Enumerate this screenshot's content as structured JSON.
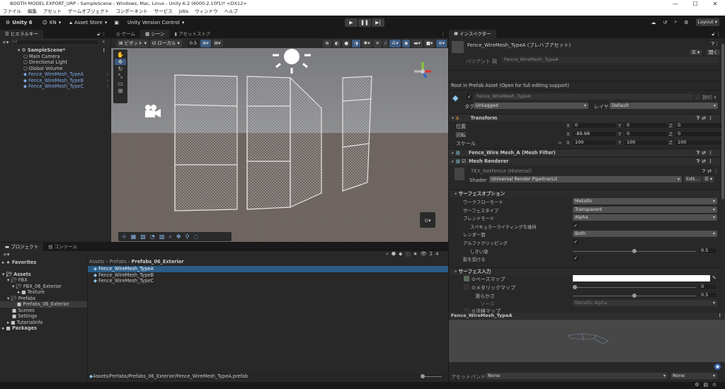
{
  "window": {
    "title": "BOOTH MODEL EXPORT_URP - SampleScene - Windows, Mac, Linux - Unity 6.2 (6000.2.10f1)* <DX12>",
    "minimize": "—",
    "maximize": "☐",
    "close": "✕"
  },
  "menu": [
    "ファイル",
    "編集",
    "アセット",
    "ゲームオブジェクト",
    "コンポーネント",
    "サービス",
    "Jobs",
    "ウィンドウ",
    "ヘルプ"
  ],
  "toolbar": {
    "unity": "Unity 6",
    "account": "KN",
    "asset_store": "Asset Store",
    "version_control": "Unity Version Control",
    "layout": "Layout"
  },
  "hierarchy": {
    "tab": "ヒエラルキー",
    "search_placeholder": "All",
    "scene": "SampleScene*",
    "items": [
      {
        "label": "Main Camera",
        "prefab": false
      },
      {
        "label": "Directional Light",
        "prefab": false
      },
      {
        "label": "Global Volume",
        "prefab": false
      },
      {
        "label": "Fence_WireMesh_TypeA",
        "prefab": true
      },
      {
        "label": "Fence_WireMesh_TypeB",
        "prefab": true
      },
      {
        "label": "Fence_WireMesh_TypeC",
        "prefab": true
      }
    ]
  },
  "scene_view": {
    "tabs": [
      "ゲーム",
      "シーン",
      "アセットストア"
    ],
    "active_tab": 1,
    "pivot": "ピボット",
    "local": "ローカル",
    "snap_value": "0.5"
  },
  "project": {
    "tabs": [
      "プロジェクト",
      "コンソール"
    ],
    "favorites": "Favorites",
    "tree": [
      {
        "label": "Assets",
        "depth": 0
      },
      {
        "label": "FBX",
        "depth": 1
      },
      {
        "label": "FBX_06_Exterior",
        "depth": 2
      },
      {
        "label": "Texture",
        "depth": 3
      },
      {
        "label": "Prefabs",
        "depth": 1
      },
      {
        "label": "Prefabs_06_Exterior",
        "depth": 2,
        "selected": true
      },
      {
        "label": "Scenes",
        "depth": 1
      },
      {
        "label": "Settings",
        "depth": 1
      },
      {
        "label": "TutorialInfo",
        "depth": 1
      },
      {
        "label": "Packages",
        "depth": 0
      }
    ],
    "breadcrumb": [
      "Assets",
      "Prefabs",
      "Prefabs_06_Exterior"
    ],
    "files": [
      "Fence_WireMesh_TypeA",
      "Fence_WireMesh_TypeB",
      "Fence_WireMesh_TypeC"
    ],
    "selected_path": "Assets/Prefabs/Prefabs_06_Exterior/Fence_WireMesh_TypeA.prefab",
    "count": "24"
  },
  "inspector": {
    "tab": "インスペクター",
    "asset_title": "Fence_WireMesh_TypeA (プレハブアセット)",
    "open": "開く",
    "variant_label": "バリアント 親",
    "variant_value": "Fence_WireMesh_TypeA",
    "root_notice": "Root in Prefab Asset (Open for full editing support)",
    "object_name": "Fence_WireMesh_TypeA",
    "static": "静的",
    "tag_label": "タグ",
    "tag": "Untagged",
    "layer_label": "レイヤー",
    "layer": "Default",
    "transform": {
      "title": "Transform",
      "rows": [
        {
          "label": "位置",
          "x": "0",
          "y": "0",
          "z": "0"
        },
        {
          "label": "回転",
          "x": "-89.98",
          "y": "0",
          "z": "0"
        },
        {
          "label": "スケール",
          "x": "100",
          "y": "100",
          "z": "100"
        }
      ]
    },
    "mesh_filter": "Fence_Wire Mesh_A (Mesh Filter)",
    "mesh_renderer": "Mesh Renderer",
    "material": "TEX_NetFence (Material)",
    "shader_label": "Shader",
    "shader": "Universal Render Pipeline/Lit",
    "edit": "Edit...",
    "surface_options": {
      "title": "サーフェスオプション",
      "workflow_label": "ワークフローモード",
      "workflow": "Metallic",
      "surface_type_label": "サーフェスタイプ",
      "surface_type": "Transparent",
      "blend_label": "ブレンドモード",
      "blend": "Alpha",
      "specular_label": "スペキュラーライティングを維持",
      "render_face_label": "レンダー面",
      "render_face": "Both",
      "alpha_clip_label": "アルファクリッピング",
      "threshold_label": "しきい値",
      "threshold": 0.5,
      "threshold_text": "0.5",
      "receive_shadows_label": "影を受ける"
    },
    "surface_inputs": {
      "title": "サーフェス入力",
      "base_map": "ベースマップ",
      "metallic_map": "メタリックマップ",
      "metallic": 0,
      "metallic_text": "0",
      "smoothness_label": "滑らかさ",
      "smoothness": 0.5,
      "smoothness_text": "0.5",
      "source_label": "ソース",
      "source": "Metallic Alpha",
      "normal_map": "法線マップ"
    },
    "preview_title": "Fence_WireMesh_TypeA",
    "asset_bundle_label": "アセットバンドル",
    "asset_bundle": "None",
    "asset_bundle_variant": "None"
  }
}
